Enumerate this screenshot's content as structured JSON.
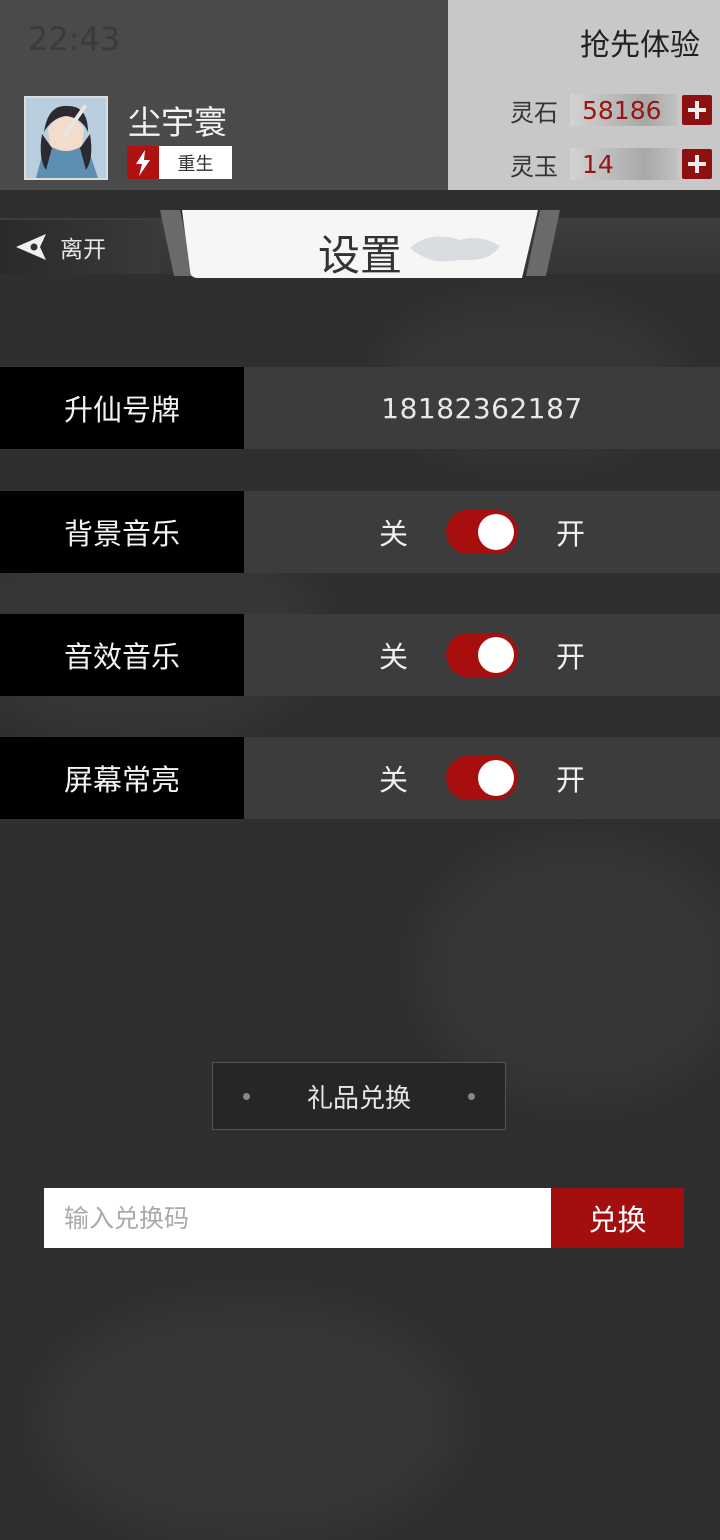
{
  "status_bar": {
    "time": "22:43"
  },
  "player": {
    "name": "尘宇寰",
    "badge_label": "重生"
  },
  "promo": {
    "early_access_label": "抢先体验"
  },
  "currencies": [
    {
      "label": "灵石",
      "value": "58186"
    },
    {
      "label": "灵玉",
      "value": "14"
    }
  ],
  "nav": {
    "leave_label": "离开",
    "title": "设置"
  },
  "settings": {
    "account": {
      "label": "升仙号牌",
      "value": "18182362187"
    },
    "toggles": [
      {
        "label": "背景音乐",
        "off_label": "关",
        "on_label": "开",
        "state": "on"
      },
      {
        "label": "音效音乐",
        "off_label": "关",
        "on_label": "开",
        "state": "on"
      },
      {
        "label": "屏幕常亮",
        "off_label": "关",
        "on_label": "开",
        "state": "on"
      }
    ]
  },
  "gift": {
    "title": "礼品兑换",
    "input_placeholder": "输入兑换码",
    "input_value": "",
    "button_label": "兑换"
  },
  "colors": {
    "accent_red": "#a70f0f",
    "row_label_bg": "#000000",
    "row_body_bg": "#3c3c3c"
  }
}
